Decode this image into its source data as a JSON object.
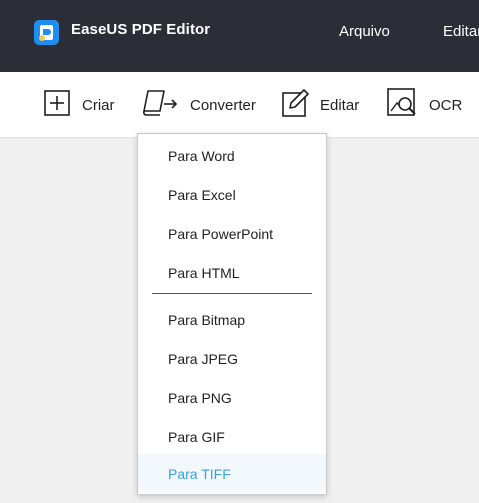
{
  "titlebar": {
    "app_name": "EaseUS PDF Editor",
    "menu": [
      "Arquivo",
      "Editar"
    ],
    "bg_color": "#2b2e36",
    "logo_color": "#1f8ef1"
  },
  "toolbar": {
    "tools": [
      {
        "label": "Criar",
        "icon": "plus-box-icon"
      },
      {
        "label": "Converter",
        "icon": "convert-icon"
      },
      {
        "label": "Editar",
        "icon": "edit-pen-icon"
      },
      {
        "label": "OCR",
        "icon": "ocr-scan-icon"
      }
    ]
  },
  "convert_menu": {
    "groups": [
      [
        "Para Word",
        "Para Excel",
        "Para PowerPoint",
        "Para HTML"
      ],
      [
        "Para Bitmap",
        "Para JPEG",
        "Para PNG",
        "Para GIF",
        "Para TIFF"
      ]
    ],
    "highlighted": "Para TIFF",
    "highlight_color": "#3aa0d9"
  }
}
